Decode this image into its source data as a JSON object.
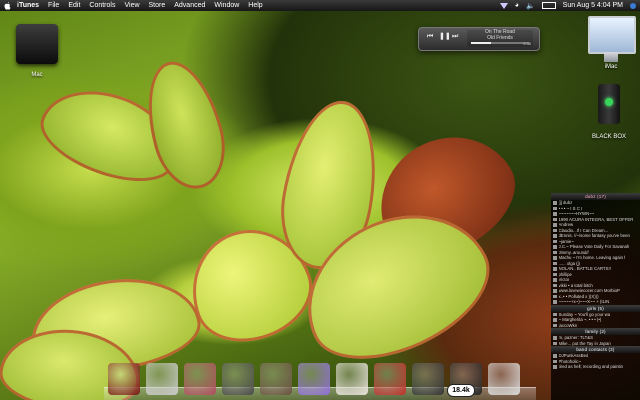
{
  "menubar": {
    "app_name": "iTunes",
    "menus": [
      "File",
      "Edit",
      "Controls",
      "View",
      "Store",
      "Advanced",
      "Window",
      "Help"
    ],
    "clock": "Sun Aug 5 4:04 PM"
  },
  "desktop": {
    "icons": [
      {
        "label": "Mac"
      },
      {
        "label": "iMac"
      },
      {
        "label": "BLACK BOX"
      }
    ]
  },
  "player": {
    "line1": "On The Road",
    "line2": "Old Friends",
    "time_left": "2:38",
    "progress": 0.35
  },
  "sidebar": {
    "sections": [
      {
        "title": "dubz (17)",
        "rows": [
          "[j] dubz",
          "• • • ~ I  S  C  I",
          "~~~~~~~HYWN~~",
          "1990 ACURA INTEGRA, BEST OFFER",
          "Andrew",
          "Claudio...If I Can Dream...",
          "dEnnis. //~/some fantasy you've been",
          "~jamie~",
          "J.C.~ Please Vote Daily For Savanah",
          "Jimmy..around//",
          "Machu ~ I'm home. Leaving again f",
          "...... olga (j)",
          "NOLAN.. BATTLE CARTS!!",
          "phillipe",
          "Victor",
          "vikki • a total bitch",
          "www.lovewiecocer.com MorbioP",
          "x..• • Polluted x    )(X)))",
          "~~~~~+x~)~~~X~~ + (ILIN"
        ]
      },
      {
        "title": "girls (5)",
        "rows": [
          "Sunday ~ You'll go your wa",
          "~ Margherita ~. • • • (•)",
          "jaccoWkn"
        ]
      },
      {
        "title": "family (2)",
        "rows": [
          "m, pazner: TLT&S",
          "Mike... put the Tay in Japan"
        ]
      },
      {
        "title": "band contacts (3)",
        "rows": [
          "DJPunkAssBed",
          "Photoholic~",
          "tired as hell; recording and paintin"
        ]
      }
    ]
  },
  "dock": {
    "items": [
      "compass-icon",
      "apple-box-icon",
      "stack-icon",
      "synth-icon",
      "boombox-icon",
      "heartagram-icon",
      "eyeball-icon",
      "figure-icon",
      "mailbox-icon",
      "gun-icon",
      "trash-icon"
    ],
    "badge": "18.4k"
  }
}
